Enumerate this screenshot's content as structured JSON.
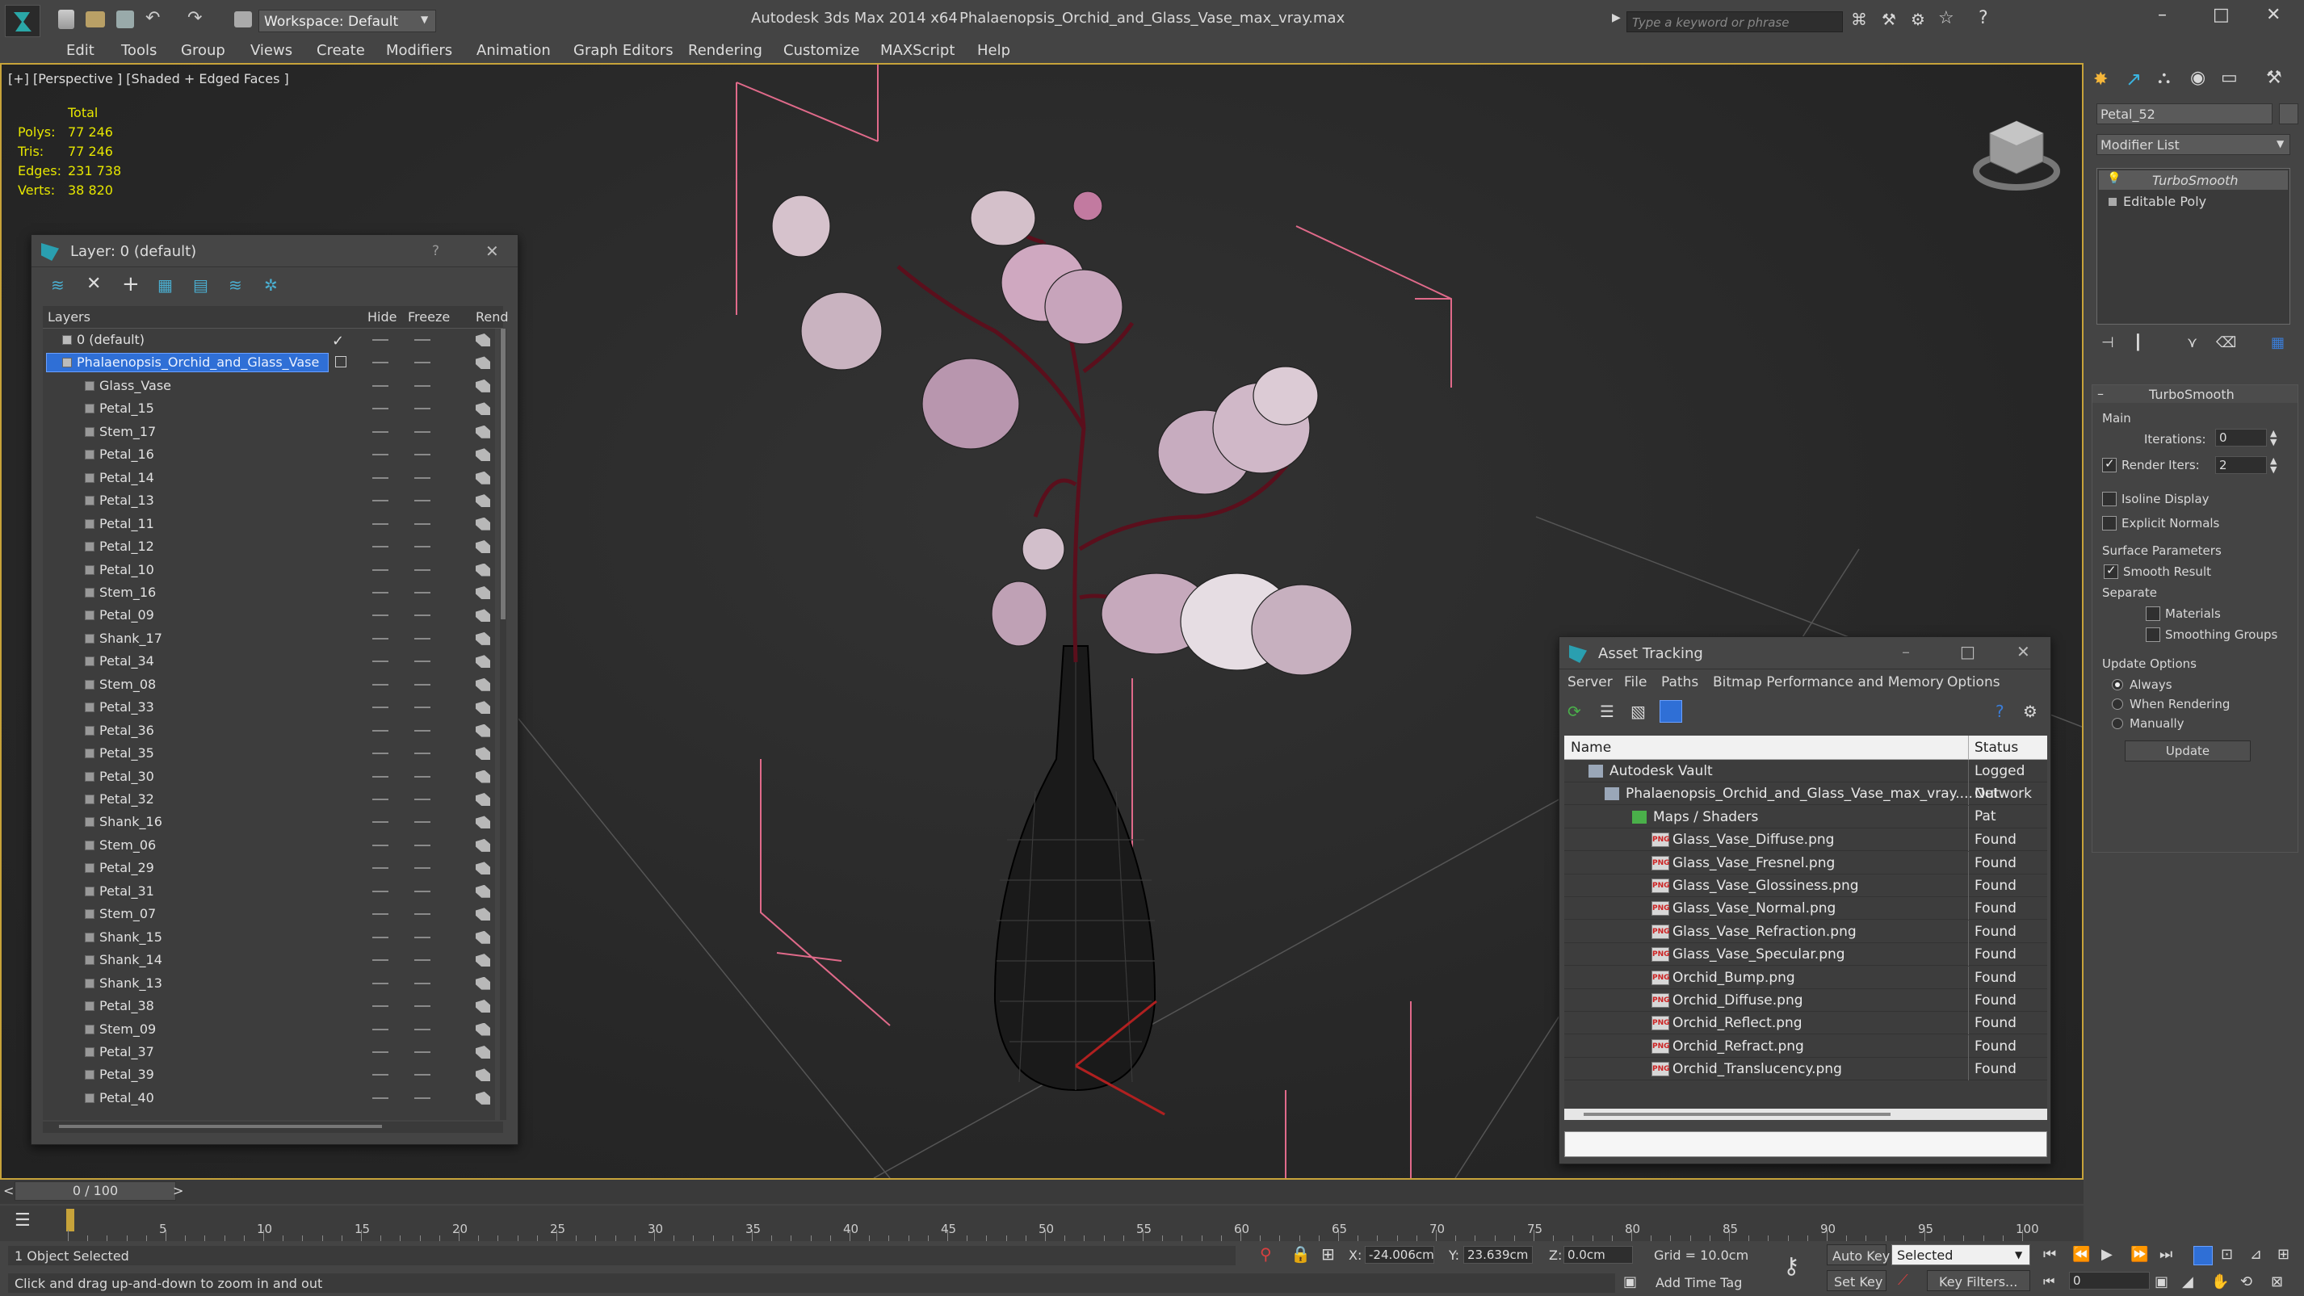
{
  "app": {
    "title": "Autodesk 3ds Max  2014 x64",
    "file": "Phalaenopsis_Orchid_and_Glass_Vase_max_vray.max",
    "workspace": "Workspace: Default",
    "search_placeholder": "Type a keyword or phrase"
  },
  "menu": [
    "Edit",
    "Tools",
    "Group",
    "Views",
    "Create",
    "Modifiers",
    "Animation",
    "Graph Editors",
    "Rendering",
    "Customize",
    "MAXScript",
    "Help"
  ],
  "viewport": {
    "label": "[+] [Perspective ] [Shaded + Edged Faces ]",
    "stats": {
      "header": "Total",
      "rows": [
        {
          "k": "Polys:",
          "v": "77 246"
        },
        {
          "k": "Tris:",
          "v": "77 246"
        },
        {
          "k": "Edges:",
          "v": "231 738"
        },
        {
          "k": "Verts:",
          "v": "38 820"
        }
      ]
    }
  },
  "layer_window": {
    "title": "Layer: 0 (default)",
    "help": "?",
    "columns": {
      "layers": "Layers",
      "hide": "Hide",
      "freeze": "Freeze",
      "render": "Rend"
    },
    "rows": [
      "0 (default)",
      "Phalaenopsis_Orchid_and_Glass_Vase",
      "Glass_Vase",
      "Petal_15",
      "Stem_17",
      "Petal_16",
      "Petal_14",
      "Petal_13",
      "Petal_11",
      "Petal_12",
      "Petal_10",
      "Stem_16",
      "Petal_09",
      "Shank_17",
      "Petal_34",
      "Stem_08",
      "Petal_33",
      "Petal_36",
      "Petal_35",
      "Petal_30",
      "Petal_32",
      "Shank_16",
      "Stem_06",
      "Petal_29",
      "Petal_31",
      "Stem_07",
      "Shank_15",
      "Shank_14",
      "Shank_13",
      "Petal_38",
      "Stem_09",
      "Petal_37",
      "Petal_39",
      "Petal_40"
    ]
  },
  "asset_window": {
    "title": "Asset Tracking",
    "menu": [
      "Server",
      "File",
      "Paths",
      "Bitmap Performance and Memory",
      "Options"
    ],
    "columns": {
      "name": "Name",
      "status": "Status"
    },
    "rows": [
      {
        "name": "Autodesk Vault",
        "status": "Logged Out"
      },
      {
        "name": "Phalaenopsis_Orchid_and_Glass_Vase_max_vray....",
        "status": "Network Pat"
      },
      {
        "name": "Maps / Shaders",
        "status": ""
      },
      {
        "name": "Glass_Vase_Diffuse.png",
        "status": "Found"
      },
      {
        "name": "Glass_Vase_Fresnel.png",
        "status": "Found"
      },
      {
        "name": "Glass_Vase_Glossiness.png",
        "status": "Found"
      },
      {
        "name": "Glass_Vase_Normal.png",
        "status": "Found"
      },
      {
        "name": "Glass_Vase_Refraction.png",
        "status": "Found"
      },
      {
        "name": "Glass_Vase_Specular.png",
        "status": "Found"
      },
      {
        "name": "Orchid_Bump.png",
        "status": "Found"
      },
      {
        "name": "Orchid_Diffuse.png",
        "status": "Found"
      },
      {
        "name": "Orchid_Reflect.png",
        "status": "Found"
      },
      {
        "name": "Orchid_Refract.png",
        "status": "Found"
      },
      {
        "name": "Orchid_Translucency.png",
        "status": "Found"
      }
    ]
  },
  "command_panel": {
    "object_name": "Petal_52",
    "modifier_list": "Modifier List",
    "stack": [
      "TurboSmooth",
      "Editable Poly"
    ],
    "rollout_title": "TurboSmooth",
    "main_label": "Main",
    "iterations_label": "Iterations:",
    "iterations_value": "0",
    "render_iters_label": "Render Iters:",
    "render_iters_value": "2",
    "isoline": "Isoline Display",
    "explicit": "Explicit Normals",
    "surface_params": "Surface Parameters",
    "smooth_result": "Smooth Result",
    "separate": "Separate",
    "materials": "Materials",
    "smoothing_groups": "Smoothing Groups",
    "update_options": "Update Options",
    "always": "Always",
    "when_rendering": "When Rendering",
    "manually": "Manually",
    "update_btn": "Update"
  },
  "timeline": {
    "frame": "0 / 100",
    "ticks": [
      "5",
      "10",
      "15",
      "20",
      "25",
      "30",
      "35",
      "40",
      "45",
      "50",
      "55",
      "60",
      "65",
      "70",
      "75",
      "80",
      "85",
      "90",
      "95",
      "100"
    ]
  },
  "status": {
    "selection": "1 Object Selected",
    "prompt": "Click and drag up-and-down to zoom in and out",
    "x_label": "X:",
    "x": "-24.006cm",
    "y_label": "Y:",
    "y": "23.639cm",
    "z_label": "Z:",
    "z": "0.0cm",
    "grid": "Grid = 10.0cm",
    "add_time_tag": "Add Time Tag",
    "auto_key": "Auto Key",
    "selected": "Selected",
    "set_key": "Set Key",
    "key_filters": "Key Filters...",
    "frame_field": "0"
  },
  "colors": {
    "accent_yellow": "#c7a33a",
    "select_blue": "#2f6fd6",
    "bbox_pink": "#e06a8a",
    "stem_red": "#5a0f1c"
  }
}
